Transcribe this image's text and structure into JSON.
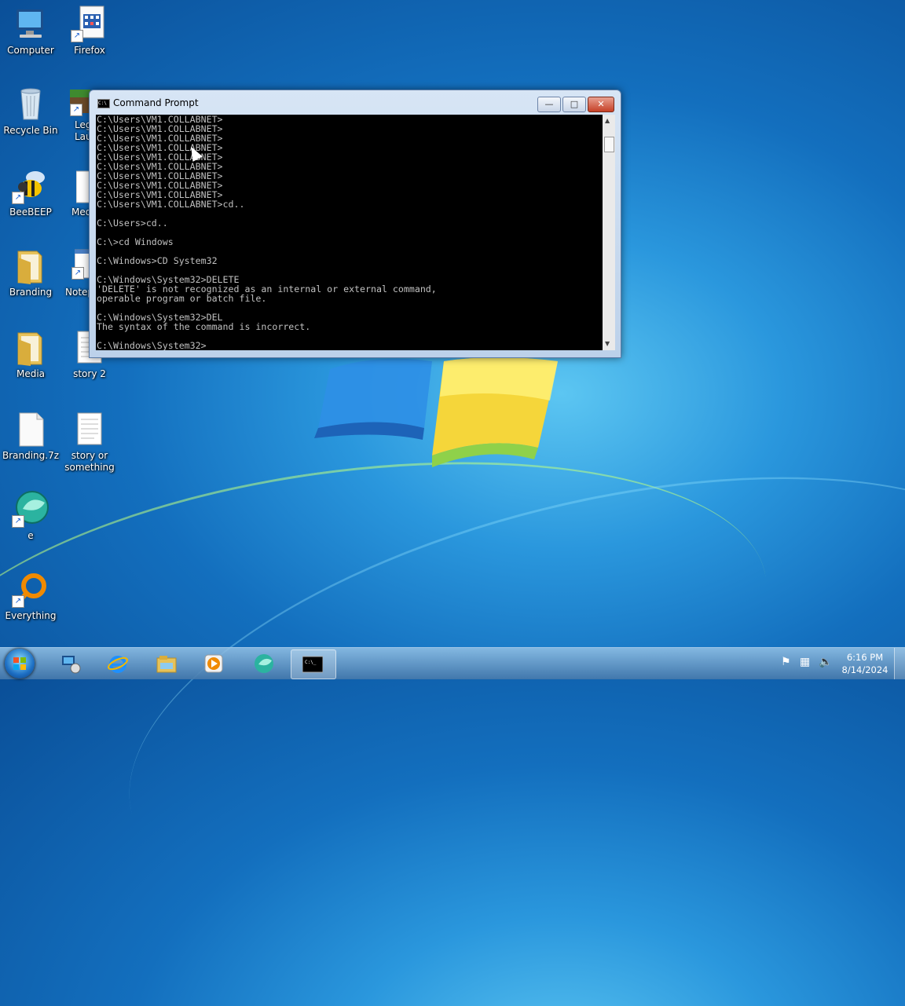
{
  "desktop": {
    "icons": [
      {
        "label": "Computer"
      },
      {
        "label": "Firefox"
      },
      {
        "label": "Recycle Bin"
      },
      {
        "label": "Leg\nLaun"
      },
      {
        "label": "BeeBEEP"
      },
      {
        "label": "Med"
      },
      {
        "label": "Branding"
      },
      {
        "label": "Notep"
      },
      {
        "label": "Media"
      },
      {
        "label": "story 2"
      },
      {
        "label": "Branding.7z"
      },
      {
        "label": "story or something"
      },
      {
        "label": "e"
      },
      {
        "label": "Everything"
      }
    ]
  },
  "cmd_window": {
    "title": "Command Prompt",
    "console_text": "C:\\Users\\VM1.COLLABNET>\nC:\\Users\\VM1.COLLABNET>\nC:\\Users\\VM1.COLLABNET>\nC:\\Users\\VM1.COLLABNET>\nC:\\Users\\VM1.COLLABNET>\nC:\\Users\\VM1.COLLABNET>\nC:\\Users\\VM1.COLLABNET>\nC:\\Users\\VM1.COLLABNET>\nC:\\Users\\VM1.COLLABNET>\nC:\\Users\\VM1.COLLABNET>cd..\n\nC:\\Users>cd..\n\nC:\\>cd Windows\n\nC:\\Windows>CD System32\n\nC:\\Windows\\System32>DELETE\n'DELETE' is not recognized as an internal or external command,\noperable program or batch file.\n\nC:\\Windows\\System32>DEL\nThe syntax of the command is incorrect.\n\nC:\\Windows\\System32>",
    "minimize_label": "—",
    "maximize_label": "□",
    "close_label": "✕"
  },
  "taskbar": {
    "clock_time": "6:16 PM",
    "clock_date": "8/14/2024",
    "pinned": [
      "network-app",
      "internet-explorer",
      "file-explorer",
      "media-player",
      "e-app",
      "command-prompt"
    ]
  },
  "colors": {
    "console_bg": "#000000",
    "console_fg": "#c0c0c0",
    "taskbar": "#4f86b8"
  }
}
